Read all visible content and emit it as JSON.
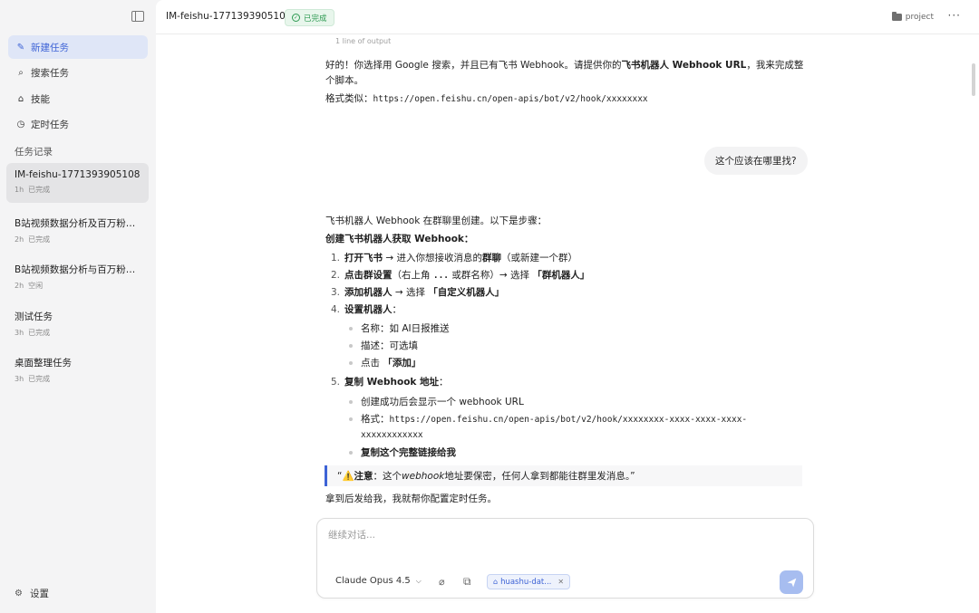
{
  "sidebar": {
    "toggle_icon": "sidebar-toggle-icon",
    "nav": [
      {
        "label": "新建任务",
        "icon": "edit-icon",
        "active": true
      },
      {
        "label": "搜索任务",
        "icon": "search-icon"
      },
      {
        "label": "技能",
        "icon": "skill-icon"
      },
      {
        "label": "定时任务",
        "icon": "clock-icon"
      }
    ],
    "section_label": "任务记录",
    "tasks": [
      {
        "title": "IM-feishu-1771393905108",
        "time": "1h",
        "status": "已完成"
      },
      {
        "title": "B站视频数据分析及百万粉增长",
        "time": "2h",
        "status": "已完成"
      },
      {
        "title": "B站视频数据分析与百万粉丝博主",
        "time": "2h",
        "status": "空闲"
      },
      {
        "title": "测试任务",
        "time": "3h",
        "status": "已完成"
      },
      {
        "title": "桌面整理任务",
        "time": "3h",
        "status": "已完成"
      }
    ],
    "settings_label": "设置"
  },
  "header": {
    "title": "IM-feishu-1771393905108",
    "status": "已完成",
    "project_label": "project",
    "more_label": "···"
  },
  "chat": {
    "output_note": "1 line of output",
    "msg1_a": "好的！你选择用 Google 搜索，并且已有飞书 Webhook。请提供你的",
    "msg1_b": "飞书机器人 Webhook URL",
    "msg1_c": "，我来完成整",
    "msg1_d": "个脚本。",
    "format_prefix": "格式类似：",
    "format_url": "https://open.feishu.cn/open-apis/bot/v2/hook/xxxxxxxx",
    "user_question": "这个应该在哪里找?",
    "answer_intro": "飞书机器人 Webhook 在群聊里创建。以下是步骤：",
    "answer_heading": "创建飞书机器人获取 Webhook：",
    "steps": [
      {
        "num": "1.",
        "bold": "打开飞书",
        "rest": " → 进入你想接收消息的",
        "bold2": "群聊",
        "rest2": "（或新建一个群）"
      },
      {
        "num": "2.",
        "bold": "点击群设置",
        "rest": "（右上角 ",
        "bold2": "...",
        "rest2": " 或群名称）→ 选择 ",
        "bold3": "「群机器人」"
      },
      {
        "num": "3.",
        "bold": "添加机器人",
        "rest": " → 选择 ",
        "bold2": "「自定义机器人」"
      },
      {
        "num": "4.",
        "bold": "设置机器人",
        "rest": "："
      },
      {
        "num": "5.",
        "bold": "复制 Webhook 地址",
        "rest": "："
      }
    ],
    "step4_subs": [
      "名称：如 AI日报推送",
      "描述：可选填",
      "点击 ",
      "「添加」"
    ],
    "step5_subs": {
      "a": "创建成功后会显示一个 webhook URL",
      "b_prefix": "格式：",
      "b_url1": "https://open.feishu.cn/open-apis/bot/v2/hook/xxxxxxxx-xxxx-xxxx-xxxx-",
      "b_url2": "xxxxxxxxxxxx",
      "c": "复制这个完整链接给我"
    },
    "quote_open": "“",
    "quote_emoji": "⚠️",
    "quote_bold": " 注意",
    "quote_a": "：这个 ",
    "quote_italic": "webhook",
    "quote_b": " 地址要保密，任何人拿到都能往群里发消息。”",
    "closing": "拿到后发给我，我就帮你配置定时任务。"
  },
  "composer": {
    "placeholder": "继续对话...",
    "model": "Claude Opus 4.5",
    "chip": "huashu-dat...",
    "send_icon": "send-icon"
  }
}
